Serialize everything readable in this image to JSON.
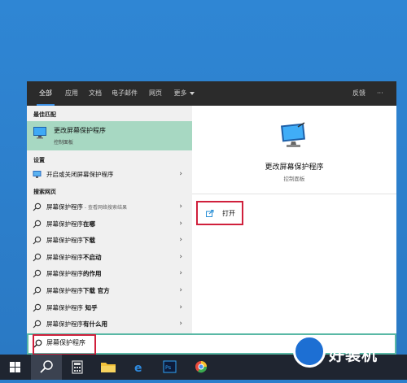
{
  "tabs": [
    "全部",
    "应用",
    "文档",
    "电子邮件",
    "网页",
    "更多"
  ],
  "header_right": {
    "feedback": "反馈",
    "more": "···"
  },
  "sections": {
    "best_match": "最佳匹配",
    "settings": "设置",
    "web": "搜索网页"
  },
  "best_match": {
    "title": "更改屏幕保护程序",
    "subtitle": "控制面板"
  },
  "settings_item": "开启或关闭屏幕保护程序",
  "web_results": [
    {
      "prefix": "屏幕保护程序",
      "suffix": "",
      "hint": " - 查看网络搜索结果"
    },
    {
      "prefix": "屏幕保护程序",
      "suffix": "在哪",
      "hint": ""
    },
    {
      "prefix": "屏幕保护程序",
      "suffix": "下载",
      "hint": ""
    },
    {
      "prefix": "屏幕保护程序",
      "suffix": "不启动",
      "hint": ""
    },
    {
      "prefix": "屏幕保护程序",
      "suffix": "的作用",
      "hint": ""
    },
    {
      "prefix": "屏幕保护程序",
      "suffix": "下载 官方",
      "hint": ""
    },
    {
      "prefix": "屏幕保护程序",
      "suffix": " 知乎",
      "hint": ""
    },
    {
      "prefix": "屏幕保护程序",
      "suffix": "有什么用",
      "hint": ""
    }
  ],
  "preview": {
    "title": "更改屏幕保护程序",
    "subtitle": "控制面板",
    "open_label": "打开"
  },
  "search": {
    "value": "屏幕保护程序"
  },
  "watermark": {
    "text": "好装机"
  },
  "colors": {
    "accent": "#3c8fe2",
    "highlight": "#a7d8c2",
    "callout": "#d0203c",
    "taskbar": "#1f2530"
  }
}
